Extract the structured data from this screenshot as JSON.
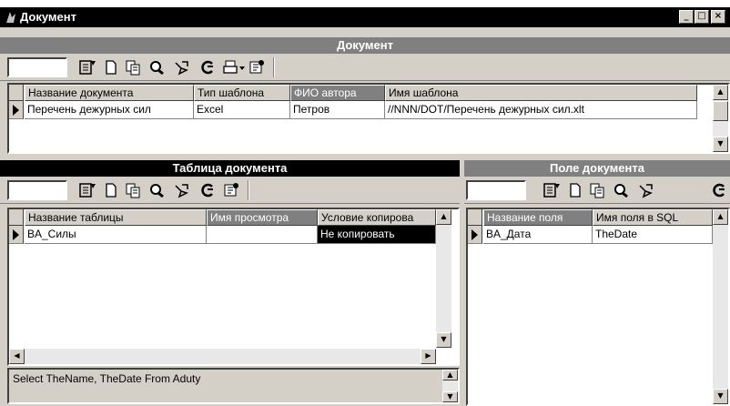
{
  "window": {
    "title": "Документ",
    "min": "_",
    "max": "□",
    "close": "×"
  },
  "doc": {
    "band": "Документ",
    "headers": [
      "Название документа",
      "Тип шаблона",
      "ФИО автора",
      "Имя шаблона"
    ],
    "row": [
      "Перечень дежурных сил",
      "Excel",
      "Петров",
      "//NNN/DOT/Перечень дежурных сил.xlt"
    ]
  },
  "table": {
    "band": "Таблица документа",
    "headers": [
      "Название таблицы",
      "Имя просмотра",
      "Условие копирова"
    ],
    "row": [
      "BA_Силы",
      "",
      "Не копировать"
    ],
    "query": "Select TheName, TheDate From Aduty"
  },
  "field": {
    "band": "Поле документа",
    "headers": [
      "Название поля",
      "Имя поля в SQL"
    ],
    "row": [
      "BA_Дата",
      "TheDate"
    ]
  },
  "icons": {
    "filter": "filter-icon",
    "new": "new-document-icon",
    "copy": "copy-icon",
    "find": "find-icon",
    "tool": "tool-icon",
    "refresh": "refresh-icon",
    "print": "print-icon",
    "props": "properties-icon"
  }
}
